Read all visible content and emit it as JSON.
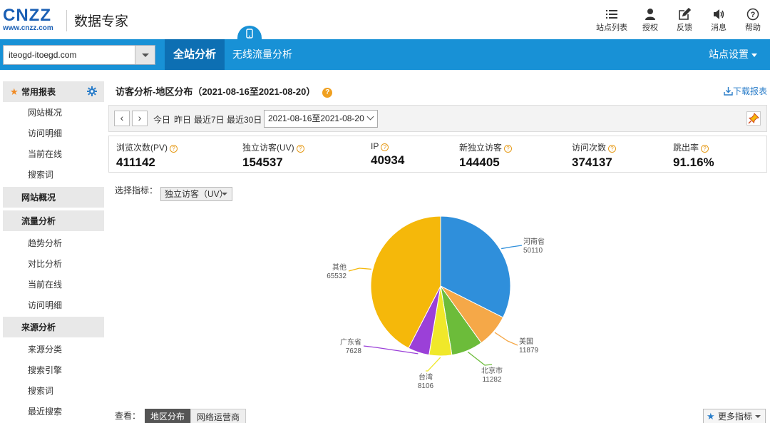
{
  "header": {
    "logo_text": "CNZZ",
    "logo_url_text": "www.cnzz.com",
    "brand": "数据专家",
    "icons": [
      {
        "name": "site-list-icon",
        "label": "站点列表"
      },
      {
        "name": "authorize-icon",
        "label": "授权"
      },
      {
        "name": "feedback-icon",
        "label": "反馈"
      },
      {
        "name": "message-icon",
        "label": "消息"
      },
      {
        "name": "help-icon",
        "label": "帮助"
      }
    ]
  },
  "nav": {
    "site_value": "iteogd-itoegd.com",
    "tabs": [
      {
        "label": "全站分析",
        "active": true
      },
      {
        "label": "无线流量分析",
        "active": false
      }
    ],
    "settings_label": "站点设置"
  },
  "sidebar": {
    "groups": [
      {
        "title": "常用报表",
        "items": [
          "网站概况",
          "访问明细",
          "当前在线",
          "搜索词"
        ]
      },
      {
        "title": "网站概况",
        "items": []
      },
      {
        "title": "流量分析",
        "items": [
          "趋势分析",
          "对比分析",
          "当前在线",
          "访问明细"
        ]
      },
      {
        "title": "来源分析",
        "items": [
          "来源分类",
          "搜索引擎",
          "搜索词",
          "最近搜索"
        ]
      }
    ]
  },
  "main": {
    "title": "访客分析-地区分布（2021-08-16至2021-08-20）",
    "download_label": "下载报表",
    "quick_dates": [
      "今日",
      "昨日",
      "最近7日",
      "最近30日"
    ],
    "date_range": "2021-08-16至2021-08-20",
    "stats": [
      {
        "label": "浏览次数(PV)",
        "value": "411142"
      },
      {
        "label": "独立访客(UV)",
        "value": "154537"
      },
      {
        "label": "IP",
        "value": "40934"
      },
      {
        "label": "新独立访客",
        "value": "144405"
      },
      {
        "label": "访问次数",
        "value": "374137"
      },
      {
        "label": "跳出率",
        "value": "91.16%"
      }
    ],
    "metric_label": "选择指标：",
    "metric_value": "独立访客（UV）",
    "view_label": "查看：",
    "view_tabs": [
      "地区分布",
      "网络运营商"
    ],
    "more_metrics": "更多指标"
  },
  "chart_data": {
    "type": "pie",
    "categories": [
      "河南省",
      "美国",
      "北京市",
      "台湾",
      "广东省",
      "其他"
    ],
    "values": [
      50110,
      11879,
      11282,
      8106,
      7628,
      65532
    ],
    "colors": [
      "#2f8fdb",
      "#f5a848",
      "#6cbc3a",
      "#f0e82a",
      "#9b40d8",
      "#f5b80a"
    ]
  }
}
